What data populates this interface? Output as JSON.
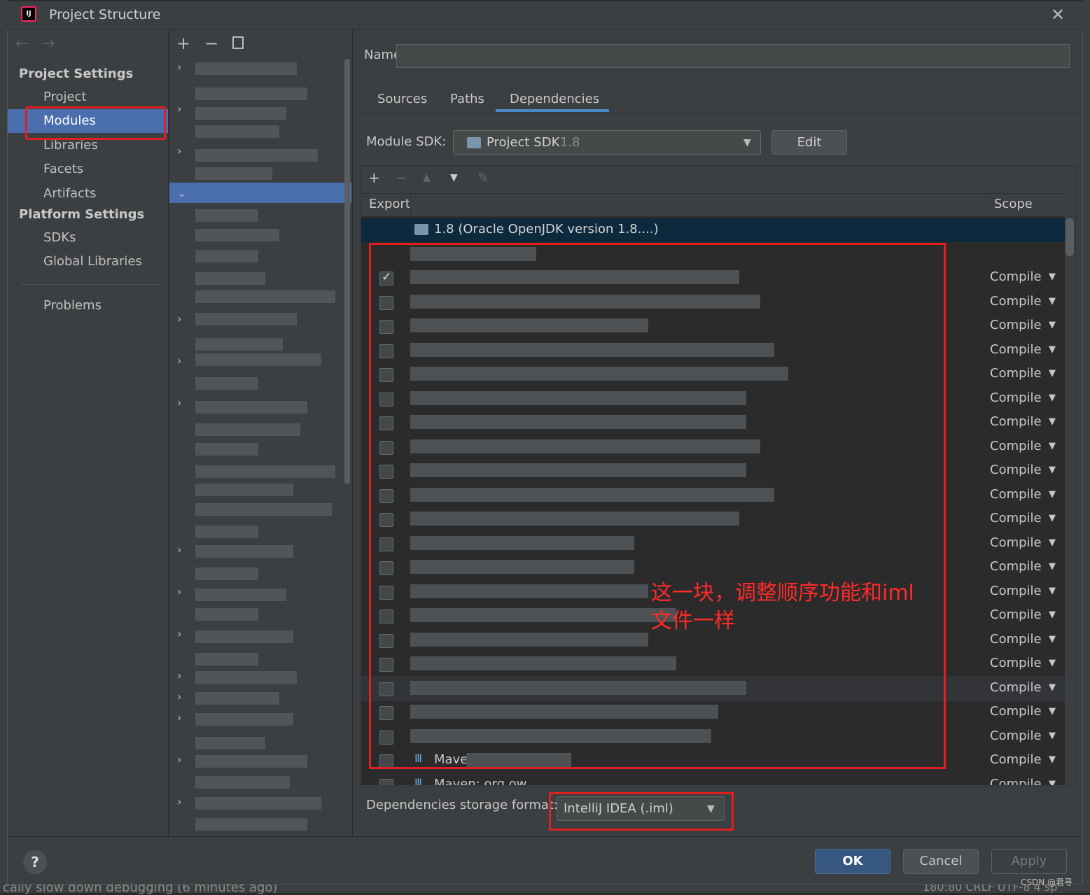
{
  "window": {
    "title": "Project Structure",
    "close": "✕"
  },
  "nav": {
    "back": "←",
    "forward": "→"
  },
  "sidebar": {
    "project_settings": "Project Settings",
    "project_items": [
      "Project",
      "Modules",
      "Libraries",
      "Facets",
      "Artifacts"
    ],
    "platform_settings": "Platform Settings",
    "platform_items": [
      "SDKs",
      "Global Libraries"
    ],
    "problems": "Problems",
    "selected": "Modules"
  },
  "tree_toolbar": {
    "add": "+",
    "remove": "−"
  },
  "main": {
    "name_label": "Name",
    "tabs": [
      "Sources",
      "Paths",
      "Dependencies"
    ],
    "active_tab": "Dependencies",
    "module_sdk_label": "Module SDK:",
    "module_sdk_value": "Project SDK",
    "module_sdk_version": "1.8",
    "edit_label": "Edit"
  },
  "dependencies": {
    "toolbar": {
      "add": "+",
      "remove": "−",
      "up": "▲",
      "down": "▼",
      "edit": "✎"
    },
    "col_export": "Export",
    "col_scope": "Scope",
    "jdk_entry": "1.8 (Oracle OpenJDK version 1.8....)",
    "scope_value": "Compile",
    "rows": [
      {
        "checked": true
      },
      {
        "checked": false
      },
      {
        "checked": false
      },
      {
        "checked": false
      },
      {
        "checked": false
      },
      {
        "checked": false
      },
      {
        "checked": false
      },
      {
        "checked": false
      },
      {
        "checked": false
      },
      {
        "checked": false
      },
      {
        "checked": false
      },
      {
        "checked": false
      },
      {
        "checked": false
      },
      {
        "checked": false
      },
      {
        "checked": false
      },
      {
        "checked": false
      },
      {
        "checked": false
      },
      {
        "checked": false
      },
      {
        "checked": false
      },
      {
        "checked": false
      },
      {
        "checked": false
      },
      {
        "checked": false
      }
    ],
    "partial_row_texts": [
      "Mave",
      "Maven: org.ow"
    ],
    "storage_label": "Dependencies storage format:",
    "storage_value": "IntelliJ IDEA (.iml)"
  },
  "annotation": "这一块，调整顺序功能和iml\n文件一样",
  "buttons": {
    "ok": "OK",
    "cancel": "Cancel",
    "apply": "Apply",
    "help": "?"
  },
  "background_ide": {
    "status_text": "cally slow down debugging (6 minutes ago)",
    "status_right": "180:80  CRLF  UTF-8  4 sp"
  },
  "watermark": "CSDN @君寻",
  "colors": {
    "selection": "#4b6eaf",
    "annotation_red": "#e02020",
    "accent_tab": "#4a88c7",
    "jdk_row": "#0d293e"
  }
}
